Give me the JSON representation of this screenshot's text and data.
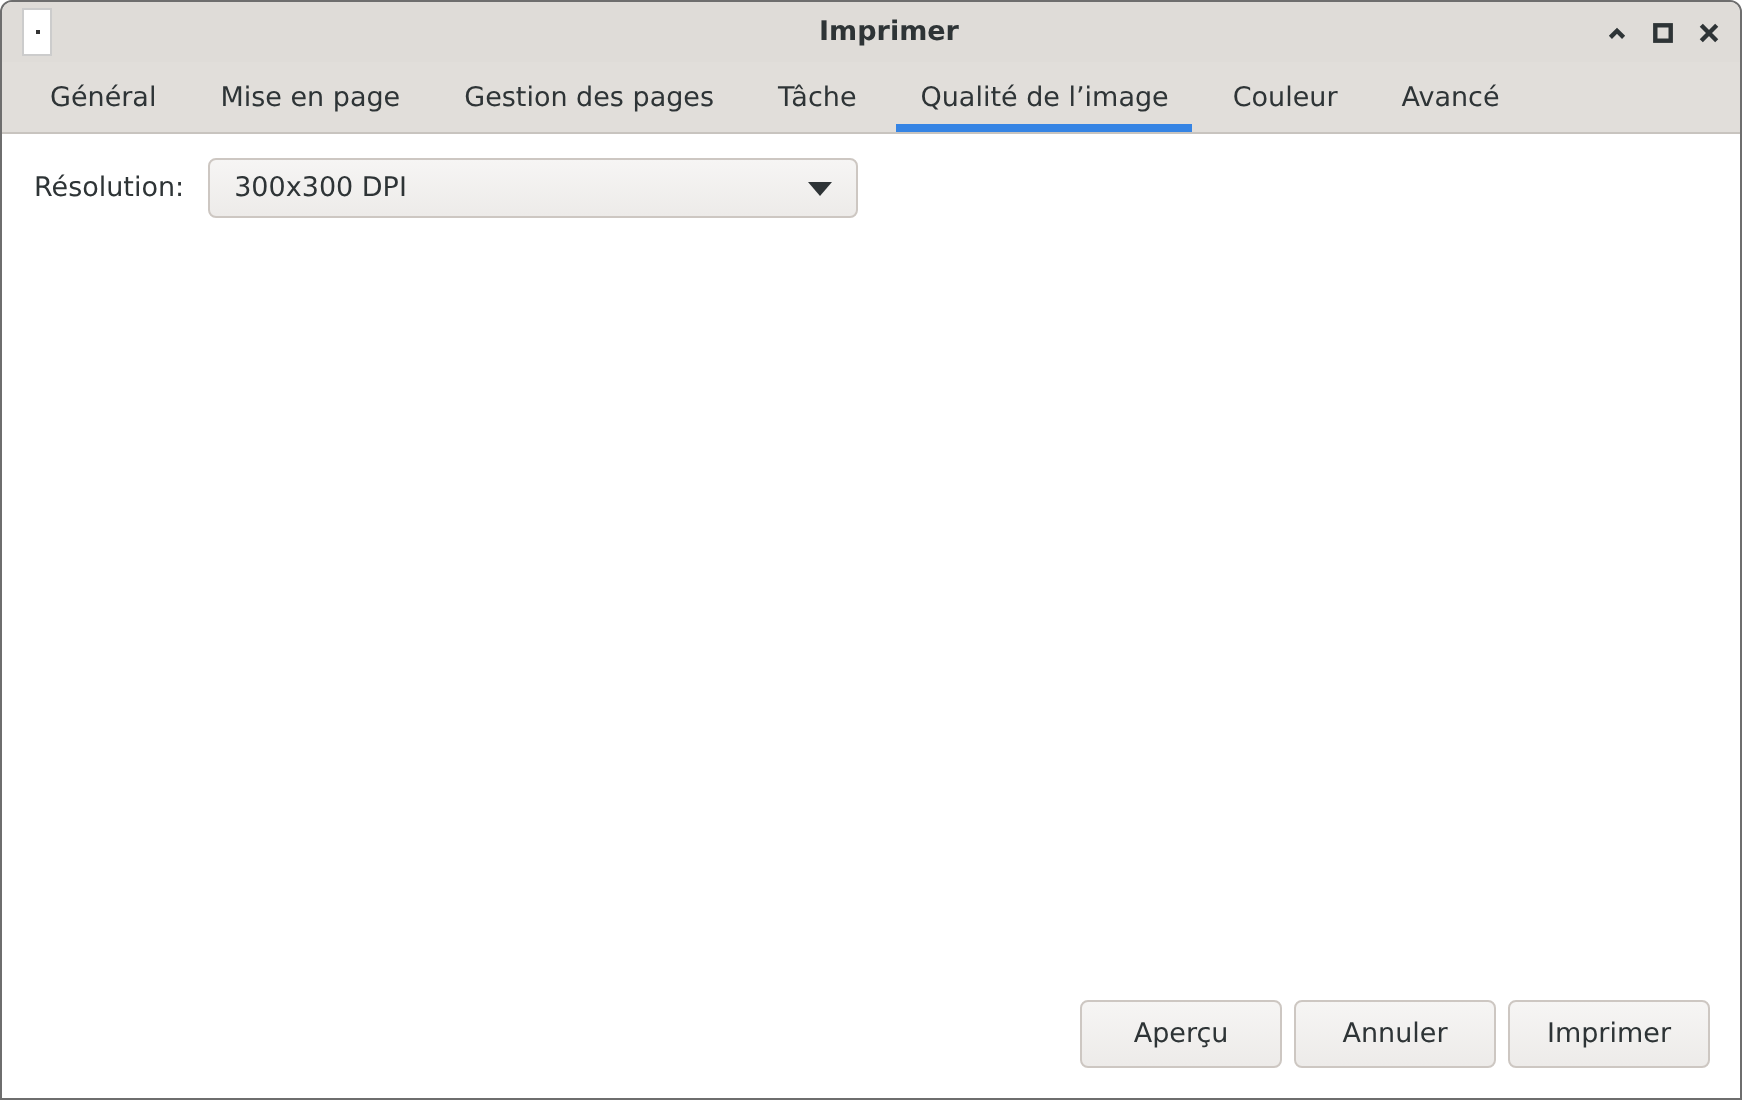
{
  "window": {
    "title": "Imprimer"
  },
  "tabs": [
    {
      "label": "Général",
      "selected": false
    },
    {
      "label": "Mise en page",
      "selected": false
    },
    {
      "label": "Gestion des pages",
      "selected": false
    },
    {
      "label": "Tâche",
      "selected": false
    },
    {
      "label": "Qualité de l’image",
      "selected": true
    },
    {
      "label": "Couleur",
      "selected": false
    },
    {
      "label": "Avancé",
      "selected": false
    }
  ],
  "resolution": {
    "label": "Résolution:",
    "value": "300x300 DPI"
  },
  "buttons": [
    "Aperçu",
    "Annuler",
    "Imprimer"
  ]
}
